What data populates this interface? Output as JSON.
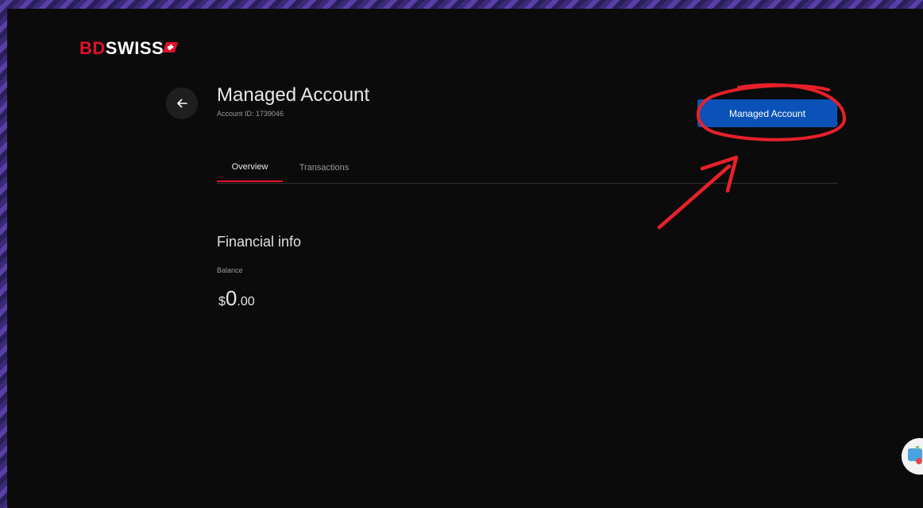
{
  "brand": {
    "part1": "BD",
    "part2": "SWISS"
  },
  "header": {
    "title": "Managed Account",
    "account_id": "Account ID: 1739046",
    "action_button": "Managed Account"
  },
  "tabs": [
    {
      "label": "Overview",
      "active": true
    },
    {
      "label": "Transactions",
      "active": false
    }
  ],
  "financial": {
    "section_title": "Financial info",
    "balance_label": "Balance",
    "currency": "$",
    "balance_int": "0",
    "balance_dec": ".00"
  },
  "colors": {
    "accent_red": "#e3102a",
    "button_blue": "#0a52b8",
    "annotation_red": "#e8202a"
  }
}
